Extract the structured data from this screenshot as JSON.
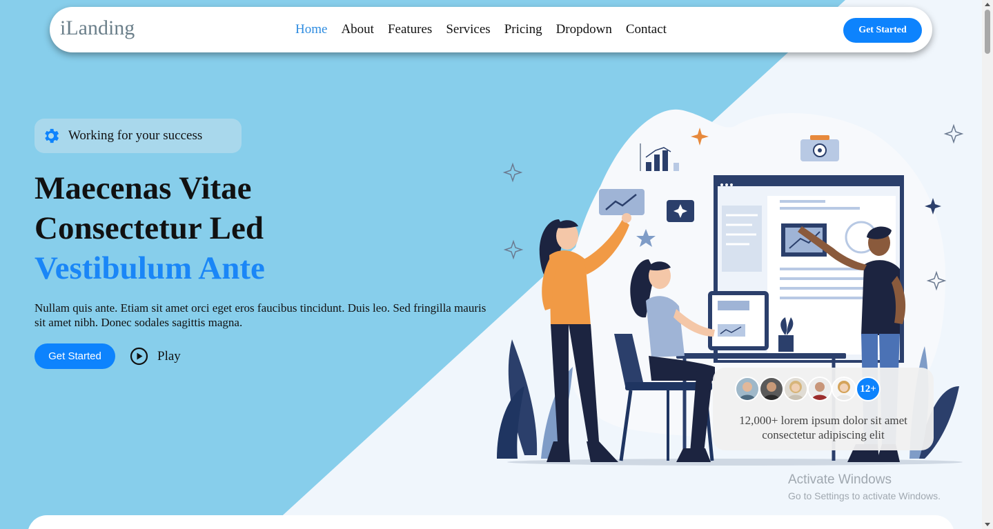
{
  "colors": {
    "hero_blue": "#87ceeb",
    "accent": "#0d83fd",
    "light_bg": "#f0f6fc"
  },
  "navbar": {
    "logo": "iLanding",
    "links": [
      "Home",
      "About",
      "Features",
      "Services",
      "Pricing",
      "Dropdown",
      "Contact"
    ],
    "active": "Home",
    "cta": "Get Started"
  },
  "hero": {
    "badge_icon": "gear-icon",
    "badge_text": "Working for your success",
    "headline_line1": "Maecenas Vitae",
    "headline_line2": "Consectetur Led",
    "headline_accent": "Vestibulum Ante",
    "lead": "Nullam quis ante. Etiam sit amet orci eget eros faucibus tincidunt. Duis leo. Sed fringilla mauris sit amet nibh. Donec sodales sagittis magna.",
    "cta": "Get Started",
    "play_icon": "play-circle-icon",
    "play": "Play"
  },
  "stats": {
    "more": "12+",
    "text": "12,000+ lorem ipsum dolor sit amet consectetur adipiscing elit"
  },
  "watermark": {
    "title": "Activate Windows",
    "subtitle": "Go to Settings to activate Windows."
  }
}
